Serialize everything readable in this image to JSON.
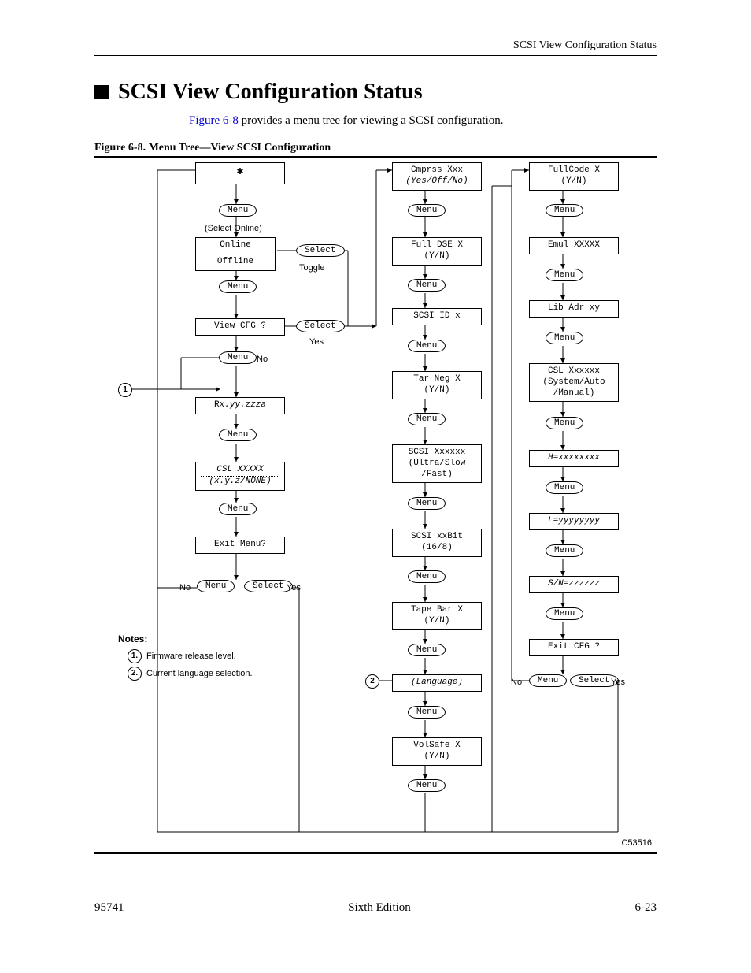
{
  "running_head": "SCSI View Configuration Status",
  "section_title": "SCSI View Configuration Status",
  "intro": {
    "figref": "Figure 6-8",
    "rest": " provides a menu tree for viewing a SCSI configuration."
  },
  "fig_caption": "Figure 6-8. Menu Tree—View SCSI Configuration",
  "labels": {
    "menu": "Menu",
    "select": "Select",
    "select_online": "(Select Online)",
    "toggle": "Toggle",
    "yes": "Yes",
    "no": "No",
    "star": "✱"
  },
  "colA": {
    "online": {
      "l1": "Online",
      "l2": "Offline"
    },
    "viewcfg": "View CFG ?",
    "rxyz": {
      "prefix": "R",
      "rest": "x.yy.zzza"
    },
    "csl": {
      "l1": "CSL XXXXX",
      "l2": "(x.y.z/NONE)"
    },
    "exitmenu": "Exit Menu?"
  },
  "colB": {
    "cmprs": {
      "l1": "Cmprss Xxx",
      "l2": "(Yes/Off/No)"
    },
    "fulldse": {
      "l1": "Full DSE X",
      "l2": "(Y/N)"
    },
    "scsiid": "SCSI ID x",
    "tarneg": {
      "l1": "Tar Neg X",
      "l2": "(Y/N)"
    },
    "scsix": {
      "l1": "SCSI Xxxxxx",
      "l2": "(Ultra/Slow",
      "l3": "/Fast)"
    },
    "scsibit": {
      "l1": "SCSI xxBit",
      "l2": "(16/8)"
    },
    "tapebar": {
      "l1": "Tape Bar X",
      "l2": "(Y/N)"
    },
    "lang": "(Language)",
    "volsafe": {
      "l1": "VolSafe X",
      "l2": "(Y/N)"
    }
  },
  "colC": {
    "fullcode": {
      "l1": "FullCode X",
      "l2": "(Y/N)"
    },
    "emul": "Emul XXXXX",
    "libadr": "Lib Adr xy",
    "csl": {
      "l1": "CSL Xxxxxx",
      "l2": "(System/Auto",
      "l3": "/Manual)"
    },
    "h": "H=xxxxxxxx",
    "l": "L=yyyyyyyy",
    "sn": "S/N=zzzzzz",
    "exitcfg": "Exit CFG ?"
  },
  "notes": {
    "head": "Notes:",
    "n1": "Firmware release level.",
    "n2": "Current language selection."
  },
  "diagram_id": "C53516",
  "footer": {
    "left": "95741",
    "center": "Sixth Edition",
    "right": "6-23"
  }
}
